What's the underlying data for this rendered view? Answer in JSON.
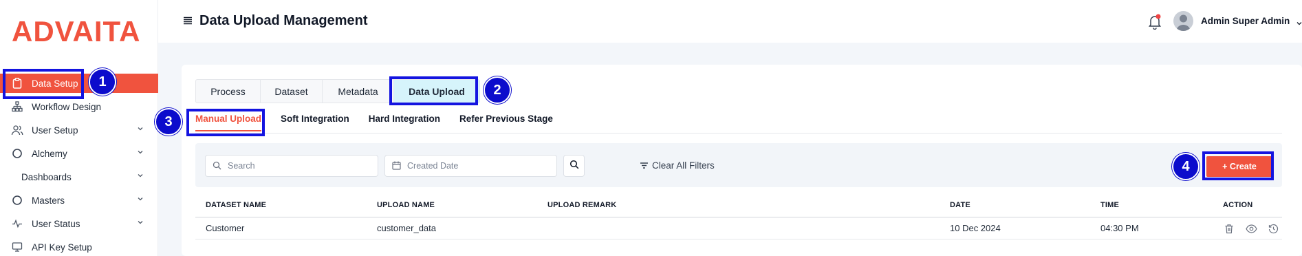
{
  "brand": {
    "logo_text": "ADVAITA",
    "accent_color": "#f0533e"
  },
  "sidebar": {
    "items": [
      {
        "label": "Data Setup",
        "icon": "clipboard-icon",
        "active": true,
        "has_chevron": false
      },
      {
        "label": "Workflow Design",
        "icon": "sitemap-icon",
        "active": false,
        "has_chevron": false
      },
      {
        "label": "User Setup",
        "icon": "users-icon",
        "active": false,
        "has_chevron": true
      },
      {
        "label": "Alchemy",
        "icon": "circle-icon",
        "active": false,
        "has_chevron": true
      },
      {
        "label": "Dashboards",
        "icon": "",
        "active": false,
        "has_chevron": true
      },
      {
        "label": "Masters",
        "icon": "circle-icon",
        "active": false,
        "has_chevron": true
      },
      {
        "label": "User Status",
        "icon": "activity-icon",
        "active": false,
        "has_chevron": true
      },
      {
        "label": "API Key Setup",
        "icon": "key-screen-icon",
        "active": false,
        "has_chevron": false
      }
    ]
  },
  "header": {
    "title": "Data Upload Management",
    "user_name": "Admin Super Admin",
    "notification_dot_color": "#ef4444"
  },
  "tabs": [
    {
      "label": "Process",
      "active": false
    },
    {
      "label": "Dataset",
      "active": false
    },
    {
      "label": "Metadata",
      "active": false
    },
    {
      "label": "Data Upload",
      "active": true
    }
  ],
  "subtabs": [
    {
      "label": "Manual Upload",
      "active": true
    },
    {
      "label": "Soft Integration",
      "active": false
    },
    {
      "label": "Hard Integration",
      "active": false
    },
    {
      "label": "Refer Previous Stage",
      "active": false
    }
  ],
  "filters": {
    "search_placeholder": "Search",
    "date_placeholder": "Created Date",
    "clear_label": "Clear All Filters",
    "create_label": "+ Create"
  },
  "table": {
    "columns": [
      "DATASET NAME",
      "UPLOAD NAME",
      "UPLOAD REMARK",
      "DATE",
      "TIME",
      "ACTION"
    ],
    "rows": [
      {
        "dataset_name": "Customer",
        "upload_name": "customer_data",
        "upload_remark": "",
        "date": "10 Dec 2024",
        "time": "04:30 PM"
      }
    ]
  },
  "annotations": {
    "step1": "1",
    "step2": "2",
    "step3": "3",
    "step4": "4",
    "color": "#1414e0"
  }
}
